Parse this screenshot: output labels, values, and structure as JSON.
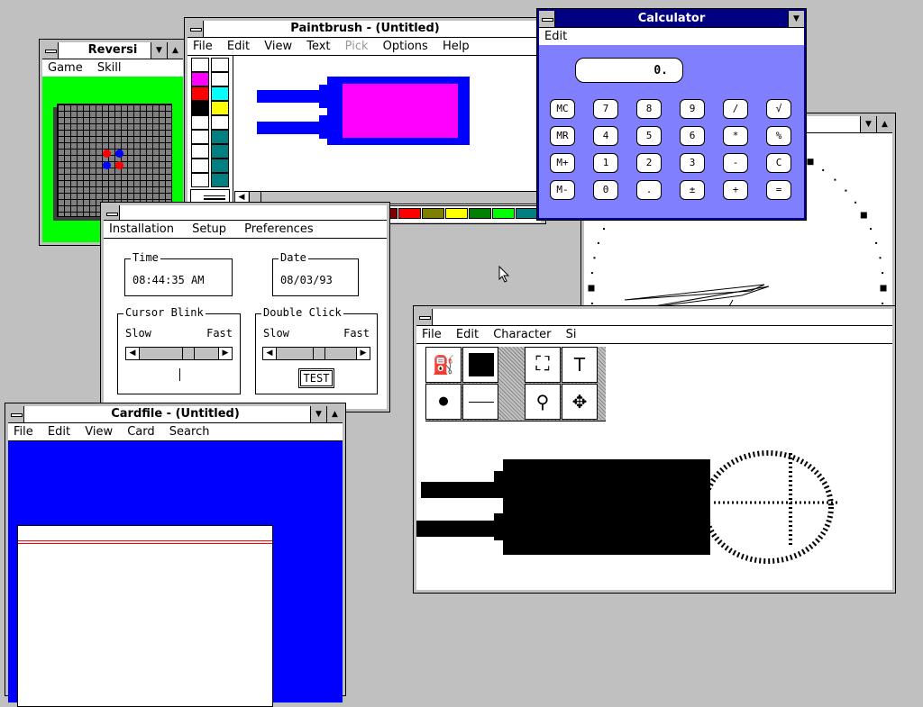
{
  "reversi": {
    "title": "Reversi",
    "menu": [
      "Game",
      "Skill"
    ]
  },
  "paintbrush": {
    "title": "Paintbrush - (Untitled)",
    "menu": [
      "File",
      "Edit",
      "View",
      "Text",
      "Pick",
      "Options",
      "Help"
    ]
  },
  "calculator": {
    "title": "Calculator",
    "menu": [
      "Edit"
    ],
    "display": "0.",
    "buttons": [
      [
        "MC",
        "7",
        "8",
        "9",
        "/",
        "√"
      ],
      [
        "MR",
        "4",
        "5",
        "6",
        "*",
        "%"
      ],
      [
        "M+",
        "1",
        "2",
        "3",
        "-",
        "C"
      ],
      [
        "M-",
        "0",
        ".",
        "±",
        "+",
        "="
      ]
    ],
    "bg_color": "#8080ff"
  },
  "control_panel": {
    "menu": [
      "Installation",
      "Setup",
      "Preferences"
    ],
    "time_label": "Time",
    "time_value": "08:44:35 AM",
    "date_label": "Date",
    "date_value": "08/03/93",
    "cursor_blink_label": "Cursor Blink",
    "double_click_label": "Double Click",
    "slow": "Slow",
    "fast": "Fast",
    "test_button": "TEST"
  },
  "cardfile": {
    "title": "Cardfile - (Untitled)",
    "menu": [
      "File",
      "Edit",
      "View",
      "Card",
      "Search"
    ],
    "bg_color": "#0000ff"
  },
  "charmap": {
    "menu": [
      "File",
      "Edit",
      "Character",
      "Si"
    ]
  },
  "palette_colors": [
    "#ffffff",
    "#000000",
    "#808080",
    "#c0c0c0",
    "#800000",
    "#ff0000",
    "#808000",
    "#ffff00",
    "#008000",
    "#00ff00",
    "#008080",
    "#00ffff",
    "#000080",
    "#0000ff",
    "#800080",
    "#ff00ff",
    "#808040",
    "#ffff80",
    "#004040",
    "#00ff80",
    "#0080ff"
  ]
}
